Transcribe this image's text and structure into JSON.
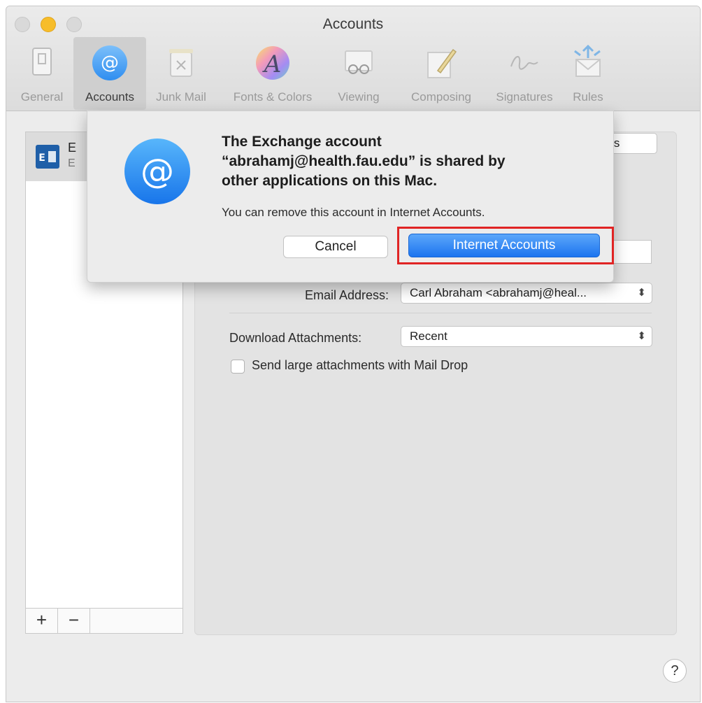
{
  "window": {
    "title": "Accounts"
  },
  "toolbar": {
    "items": [
      {
        "label": "General",
        "icon": "switch-icon"
      },
      {
        "label": "Accounts",
        "icon": "at-sign-icon"
      },
      {
        "label": "Junk Mail",
        "icon": "trash-icon"
      },
      {
        "label": "Fonts & Colors",
        "icon": "font-color-icon"
      },
      {
        "label": "Viewing",
        "icon": "glasses-icon"
      },
      {
        "label": "Composing",
        "icon": "pencil-icon"
      },
      {
        "label": "Signatures",
        "icon": "signature-icon"
      },
      {
        "label": "Rules",
        "icon": "envelope-arrows-icon"
      }
    ],
    "active": "Accounts"
  },
  "sidebar": {
    "account": {
      "name": "E",
      "sub": "E"
    },
    "add_label": "+",
    "remove_label": "−"
  },
  "pane": {
    "settings_button": "ngs",
    "email_label": "Email Address:",
    "email_value": "Carl Abraham <abrahamj@heal...",
    "download_label": "Download Attachments:",
    "download_value": "Recent",
    "maildrop_label": "Send large attachments with Mail Drop"
  },
  "dialog": {
    "title_line1": "The Exchange account",
    "title_line2": "“abrahamj@health.fau.edu” is shared by",
    "title_line3": "other applications on this Mac.",
    "message": "You can remove this account in Internet Accounts.",
    "cancel_label": "Cancel",
    "primary_label": "Internet Accounts"
  },
  "help_label": "?",
  "colors": {
    "primary": "#1c74ef",
    "highlight": "#e02424",
    "minimize": "#f7bd2a"
  }
}
